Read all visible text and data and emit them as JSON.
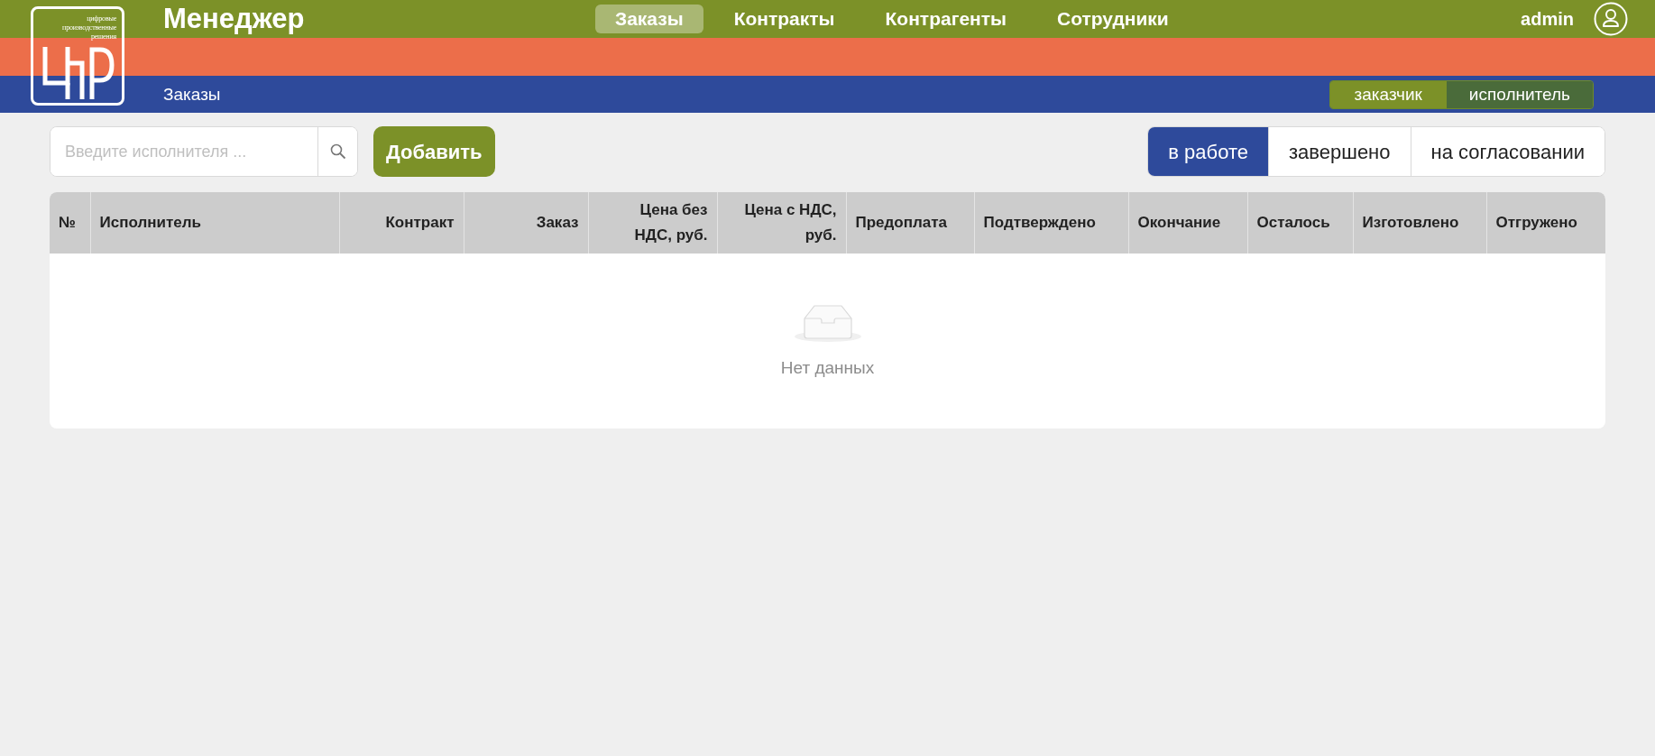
{
  "logo": {
    "tagline": "цифровые производственные решения"
  },
  "app_title": "Менеджер",
  "nav": [
    {
      "label": "Заказы",
      "selected": true
    },
    {
      "label": "Контракты",
      "selected": false
    },
    {
      "label": "Контрагенты",
      "selected": false
    },
    {
      "label": "Сотрудники",
      "selected": false
    }
  ],
  "user": {
    "name": "admin"
  },
  "breadcrumb": "Заказы",
  "roles": [
    {
      "label": "заказчик",
      "selected": false
    },
    {
      "label": "исполнитель",
      "selected": true
    }
  ],
  "search": {
    "placeholder": "Введите исполнителя ..."
  },
  "add_button": "Добавить",
  "status_tabs": [
    {
      "label": "в работе",
      "selected": true
    },
    {
      "label": "завершено",
      "selected": false
    },
    {
      "label": "на согласовании",
      "selected": false
    }
  ],
  "table": {
    "columns": [
      {
        "label": "№"
      },
      {
        "label": "Исполнитель"
      },
      {
        "label": "Контракт"
      },
      {
        "label": "Заказ"
      },
      {
        "label": "Цена без НДС, руб."
      },
      {
        "label": "Цена с НДС, руб."
      },
      {
        "label": "Предоплата"
      },
      {
        "label": "Подтверждено"
      },
      {
        "label": "Окончание"
      },
      {
        "label": "Осталось"
      },
      {
        "label": "Изготовлено"
      },
      {
        "label": "Отгружено"
      }
    ],
    "empty_text": "Нет данных"
  }
}
